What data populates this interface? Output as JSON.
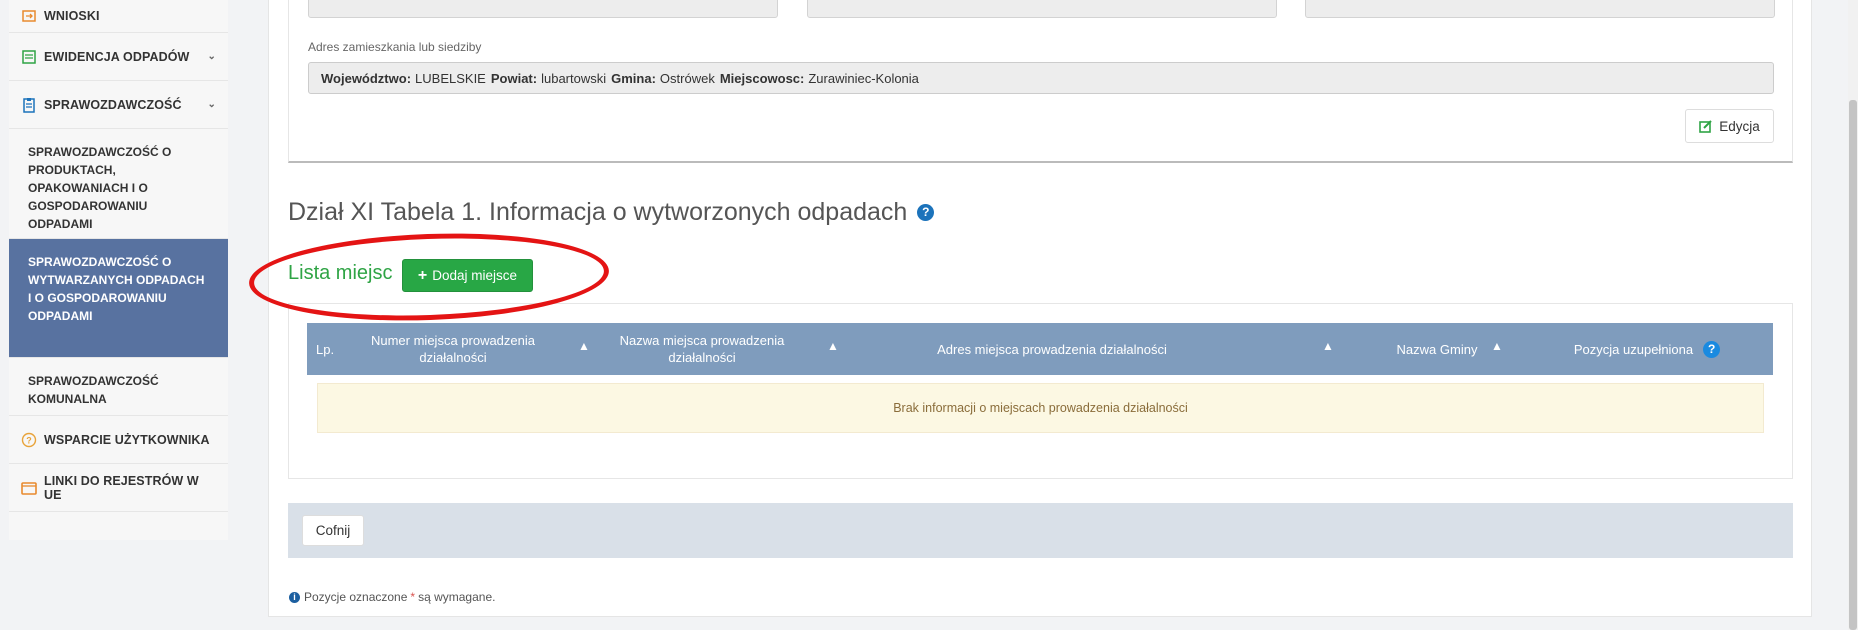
{
  "sidebar": {
    "items": [
      {
        "label": "WNIOSKI",
        "icon": "form-icon"
      },
      {
        "label": "EWIDENCJA ODPADÓW",
        "icon": "list-icon"
      },
      {
        "label": "SPRAWOZDAWCZOŚĆ",
        "icon": "clipboard-icon"
      }
    ],
    "sub_items": [
      {
        "label": "SPRAWOZDAWCZOŚĆ O PRODUKTACH, OPAKOWANIACH I O GOSPODAROWANIU ODPADAMI"
      },
      {
        "label": "SPRAWOZDAWCZOŚĆ O WYTWARZANYCH ODPADACH I O GOSPODAROWANIU ODPADAMI"
      },
      {
        "label": "SPRAWOZDAWCZOŚĆ KOMUNALNA"
      }
    ],
    "support_label": "WSPARCIE UŻYTKOWNIKA",
    "links_label": "LINKI DO REJESTRÓW W UE",
    "accent_color": "#5872a0",
    "icon_color": "#2fa445"
  },
  "address": {
    "label": "Adres zamieszkania lub siedziby",
    "wojewodztwo_key": "Województwo:",
    "wojewodztwo_val": "LUBELSKIE",
    "powiat_key": "Powiat:",
    "powiat_val": "lubartowski",
    "gmina_key": "Gmina:",
    "gmina_val": "Ostrówek",
    "miejscowosc_key": "Miejscowosc:",
    "miejscowosc_val": "Zurawiniec-Kolonia",
    "edit_label": "Edycja"
  },
  "section": {
    "title": "Dział XI Tabela 1. Informacja o wytworzonych odpadach",
    "help": "?"
  },
  "places": {
    "title": "Lista miejsc",
    "add_label": "Dodaj miejsce",
    "columns": [
      "Lp.",
      "Numer miejsca prowadzenia działalności",
      "Nazwa miejsca prowadzenia działalności",
      "Adres miejsca prowadzenia działalności",
      "Nazwa Gminy",
      "Pozycja uzupełniona"
    ],
    "empty_message": "Brak informacji o miejscach prowadzenia działalności",
    "header_color": "#7f9cbd"
  },
  "footer": {
    "back_label": "Cofnij",
    "note_prefix": "Pozycje oznaczone",
    "note_star": "*",
    "note_suffix": "są wymagane."
  }
}
